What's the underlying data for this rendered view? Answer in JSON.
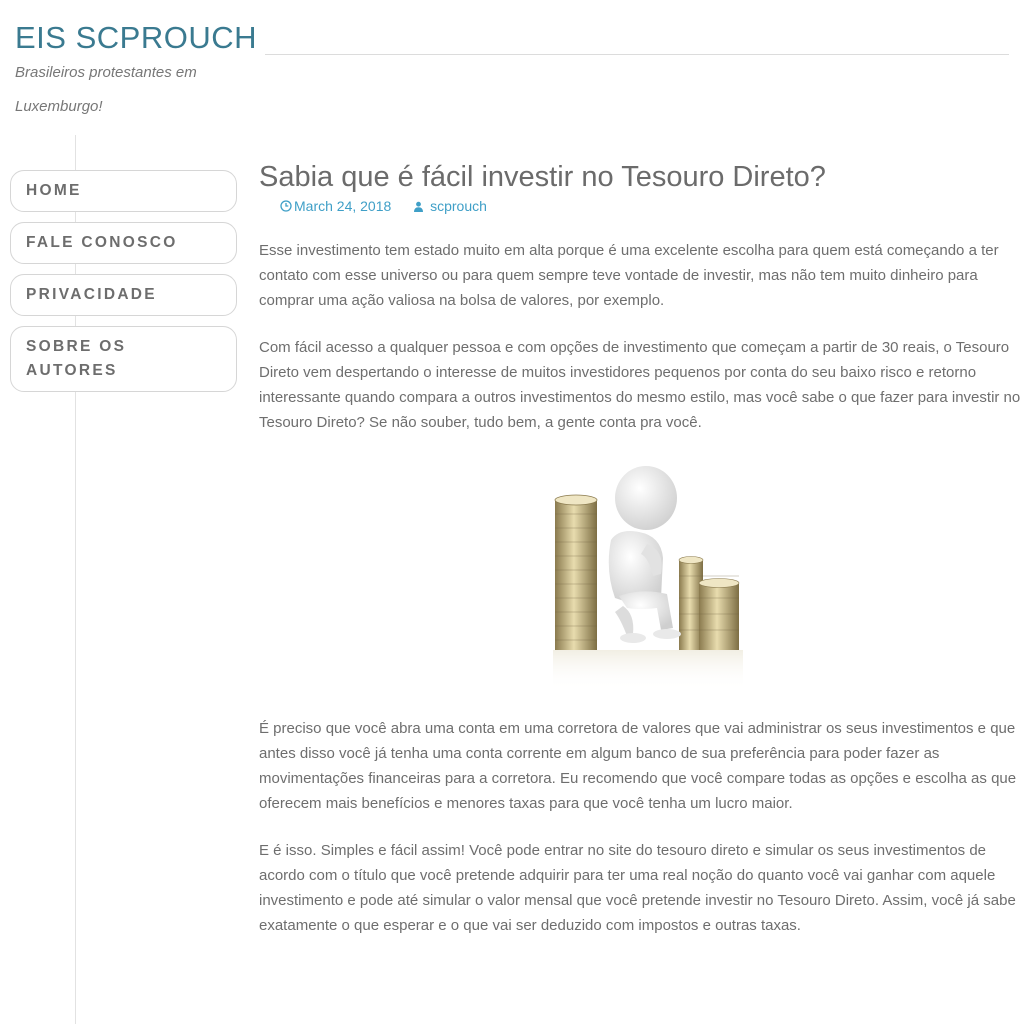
{
  "site": {
    "title": "EIS SCPROUCH",
    "tagline": "Brasileiros protestantes em Luxemburgo!"
  },
  "nav": {
    "items": [
      {
        "label": "HOME"
      },
      {
        "label": "FALE CONOSCO"
      },
      {
        "label": "PRIVACIDADE"
      },
      {
        "label": "SOBRE OS AUTORES"
      }
    ]
  },
  "post": {
    "title": "Sabia que é fácil investir no Tesouro Direto?",
    "date": "March 24, 2018",
    "author": "scprouch",
    "paragraphs": [
      "Esse investimento tem estado muito em alta porque é uma excelente escolha para quem está começando a ter contato com esse universo ou para quem sempre teve vontade de investir, mas não tem muito dinheiro para comprar uma ação valiosa na bolsa de valores, por exemplo.",
      "Com fácil acesso a qualquer pessoa e com opções de investimento que começam a partir de 30 reais, o Tesouro Direto vem despertando o interesse de muitos investidores pequenos por conta do seu baixo risco e retorno interessante quando compara a outros investimentos do mesmo estilo, mas você sabe o que fazer para investir no Tesouro Direto? Se não souber, tudo bem, a gente conta pra você.",
      "É preciso que você abra uma conta em uma corretora de valores que vai administrar os seus investimentos e que antes disso você já tenha uma conta corrente em algum banco de sua preferência para poder fazer as movimentações financeiras para a corretora. Eu recomendo que você compare todas as opções e escolha as que oferecem mais benefícios e menores taxas para que você tenha um lucro maior.",
      "E é isso. Simples e fácil assim! Você pode entrar no site do tesouro direto e simular os seus investimentos de acordo com o título que você pretende adquirir para ter uma real noção do quanto você vai ganhar com aquele investimento e pode até simular o valor mensal que você pretende investir no Tesouro Direto. Assim, você já sabe exatamente o que esperar e o que vai ser deduzido com impostos e outras taxas."
    ]
  },
  "icons": {
    "date": "clock-icon",
    "author": "user-icon"
  },
  "colors": {
    "site_title": "#3a7a90",
    "meta_link": "#3f9fc7",
    "text": "#6e6e6e"
  }
}
